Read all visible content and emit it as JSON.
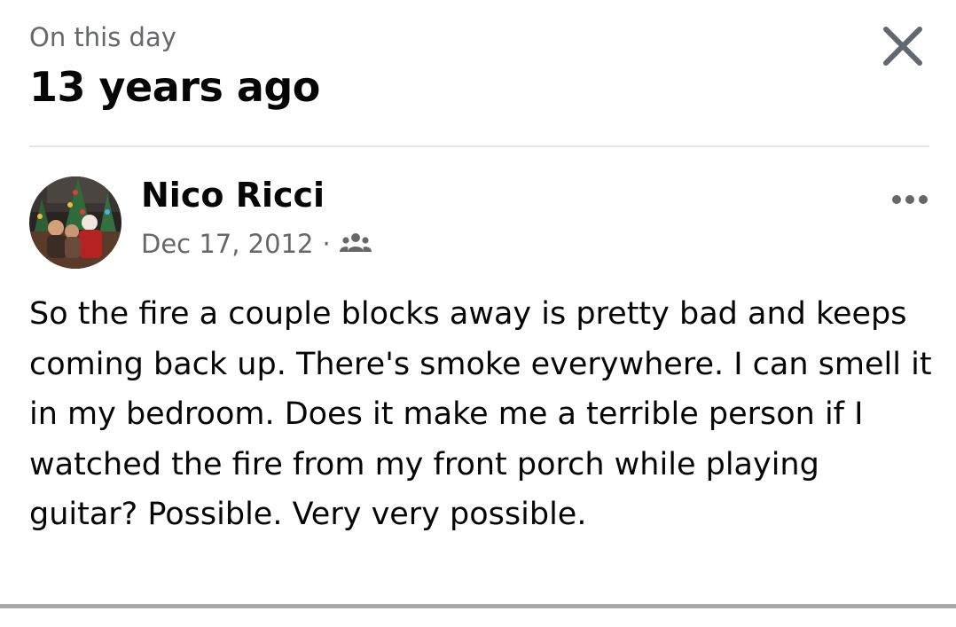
{
  "header": {
    "eyebrow": "On this day",
    "title": "13 years ago",
    "close_icon": "close-icon"
  },
  "post": {
    "author": "Nico Ricci",
    "date": "Dec 17, 2012",
    "separator": "·",
    "audience_icon": "friends-icon",
    "more_icon": "more-horizontal-icon",
    "text": "So the fire a couple blocks away is pretty bad and keeps coming back up. There's smoke everywhere. I can smell it in my bedroom. Does it make me a terrible person if I watched the fire from my front porch while playing guitar? Possible. Very very possible."
  },
  "colors": {
    "primary_text": "#050505",
    "secondary_text": "#65676b",
    "divider": "#e4e6eb",
    "bottom_bar": "#a8a8a8"
  }
}
